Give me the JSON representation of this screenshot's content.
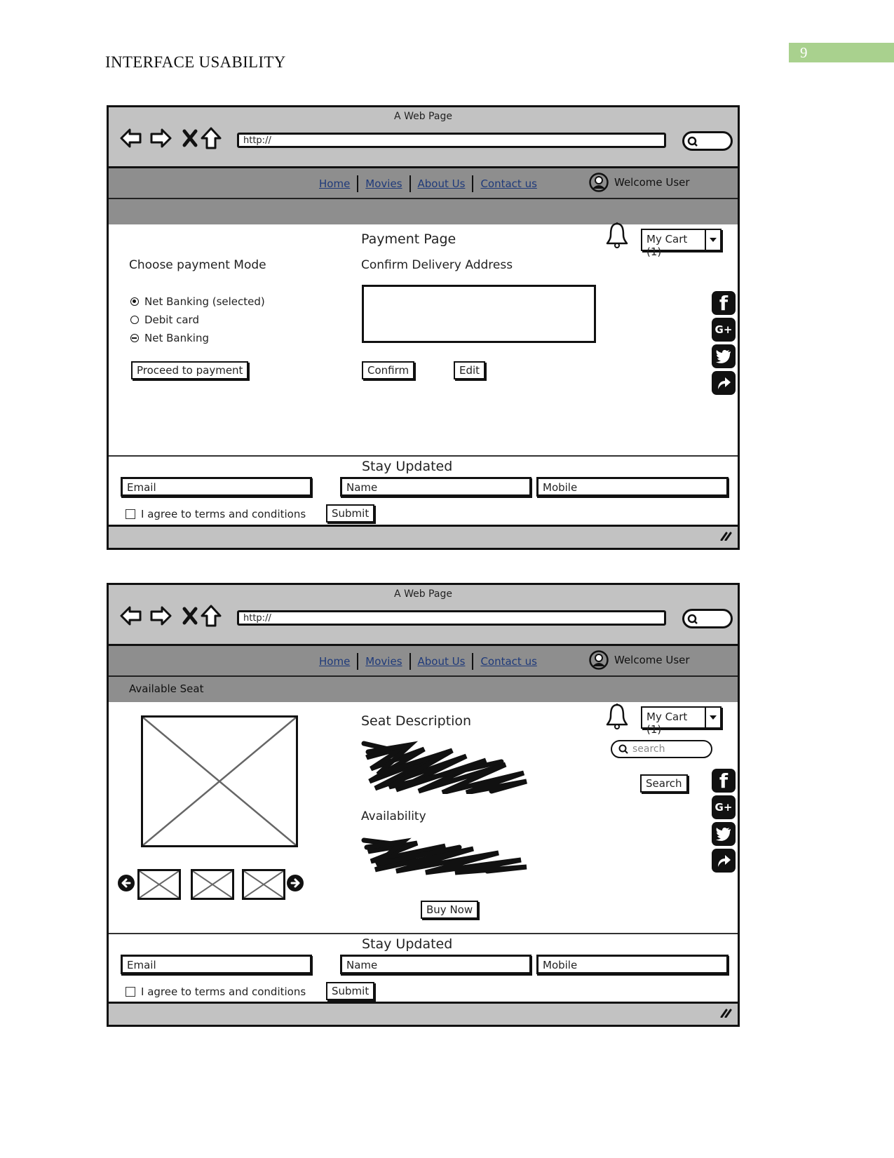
{
  "document": {
    "header": "INTERFACE USABILITY",
    "page_number": "9",
    "page_number_bg": "#a9d18e"
  },
  "mockups": [
    {
      "window_title": "A Web Page",
      "url": "http://",
      "nav_links": [
        "Home",
        "Movies",
        "About Us",
        "Contact us"
      ],
      "welcome": "Welcome User",
      "subbar_label": "",
      "page_title": "Payment Page",
      "cart_label": "My Cart (1)",
      "payment": {
        "heading": "Choose payment Mode",
        "options": [
          {
            "label": "Net Banking (selected)",
            "state": "selected"
          },
          {
            "label": "Debit card",
            "state": "unselected"
          },
          {
            "label": "Net Banking",
            "state": "indeterminate"
          }
        ],
        "proceed_button": "Proceed to payment"
      },
      "delivery": {
        "heading": "Confirm Delivery Address",
        "address_value": "",
        "confirm_button": "Confirm",
        "edit_button": "Edit"
      },
      "social_icons": [
        "facebook-icon",
        "google-plus-icon",
        "twitter-icon",
        "share-icon"
      ],
      "footer": {
        "heading": "Stay Updated",
        "email_placeholder": "Email",
        "name_placeholder": "Name",
        "mobile_placeholder": "Mobile",
        "terms_label": "I agree to terms and conditions",
        "terms_checked": false,
        "submit_button": "Submit"
      }
    },
    {
      "window_title": "A Web Page",
      "url": "http://",
      "nav_links": [
        "Home",
        "Movies",
        "About Us",
        "Contact us"
      ],
      "welcome": "Welcome User",
      "subbar_label": "Available Seat",
      "cart_label": "My Cart (1)",
      "seat": {
        "description_heading": "Seat Description",
        "availability_heading": "Availability",
        "buy_button": "Buy Now",
        "thumbnail_count": 3
      },
      "search": {
        "placeholder": "search",
        "button": "Search"
      },
      "social_icons": [
        "facebook-icon",
        "google-plus-icon",
        "twitter-icon",
        "share-icon"
      ],
      "footer": {
        "heading": "Stay Updated",
        "email_placeholder": "Email",
        "name_placeholder": "Name",
        "mobile_placeholder": "Mobile",
        "terms_label": "I agree to terms and conditions",
        "terms_checked": false,
        "submit_button": "Submit"
      }
    }
  ]
}
